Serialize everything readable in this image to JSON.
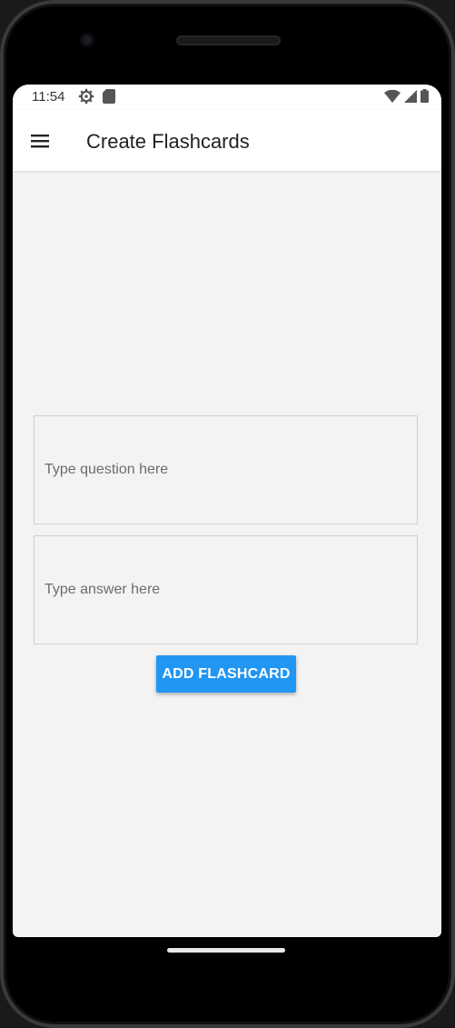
{
  "status_bar": {
    "time": "11:54",
    "left_icons": [
      "settings-gear-icon",
      "sd-card-icon"
    ],
    "right_icons": [
      "wifi-icon",
      "cell-signal-icon",
      "battery-icon"
    ]
  },
  "app_bar": {
    "menu_icon": "hamburger-menu-icon",
    "title": "Create Flashcards"
  },
  "form": {
    "question_placeholder": "Type question here",
    "question_value": "",
    "answer_placeholder": "Type answer here",
    "answer_value": "",
    "add_button_label": "ADD FLASHCARD"
  },
  "colors": {
    "accent": "#2196f3",
    "background": "#f3f3f3",
    "app_bar": "#ffffff"
  }
}
